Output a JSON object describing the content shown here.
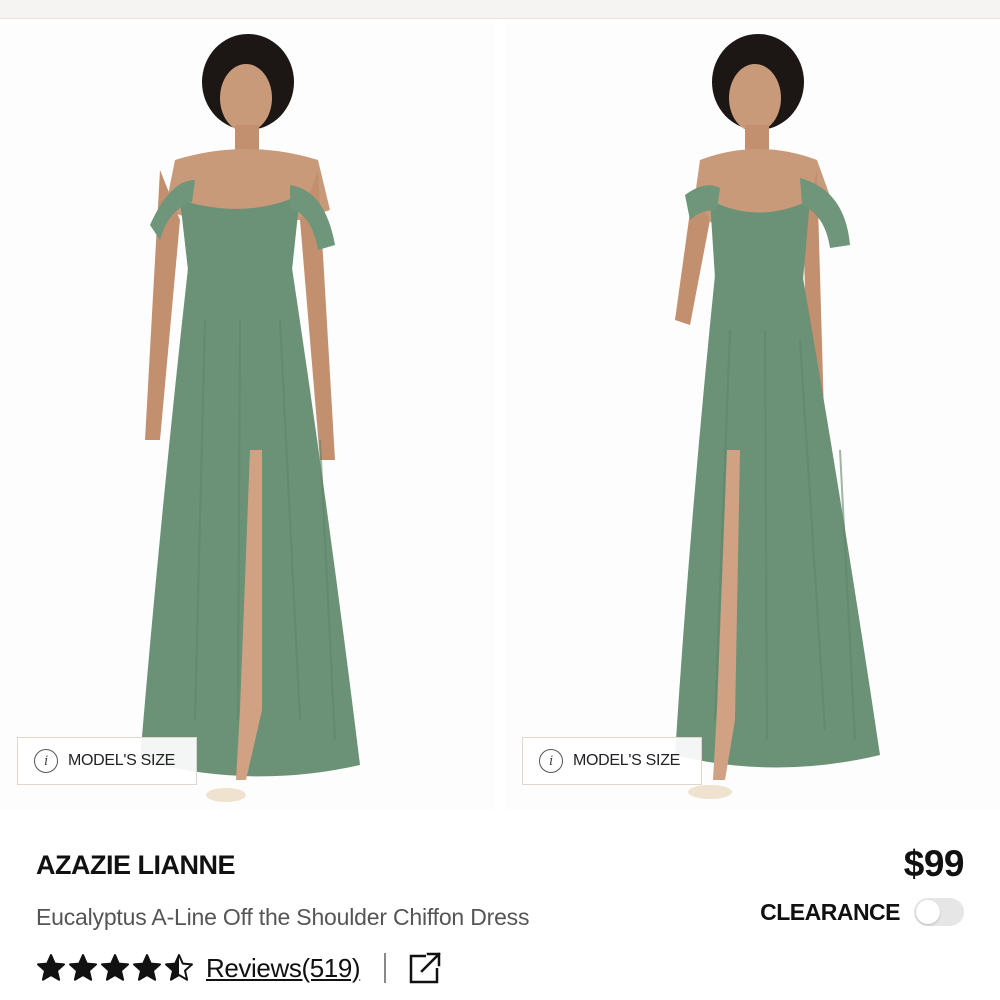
{
  "gallery": {
    "images": [
      {
        "alt": "",
        "dress_color": "#6b9177"
      },
      {
        "alt": "",
        "dress_color": "#6b9177"
      }
    ],
    "model_size_label": "MODEL'S SIZE",
    "info_icon": "info-icon",
    "info_glyph": "i"
  },
  "product": {
    "brand": "AZAZIE LIANNE",
    "title": "Eucalyptus A-Line Off the Shoulder Chiffon Dress",
    "price": "$99",
    "clearance_label": "CLEARANCE",
    "clearance_enabled": false,
    "rating": 4.5,
    "rating_max": 5,
    "reviews_label": "Reviews(519)",
    "share_icon": "external-link-icon"
  },
  "colors": {
    "dress": "#6b9177",
    "text": "#111111",
    "muted": "#555555",
    "toggle_off": "#e6e6e6"
  }
}
